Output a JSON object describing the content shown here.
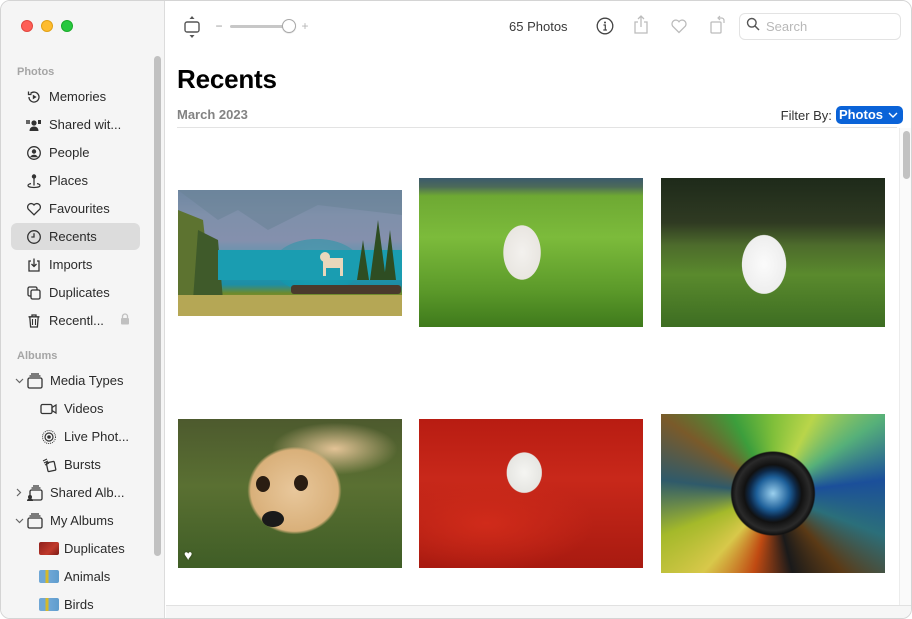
{
  "window": {
    "traffic_lights": [
      "close",
      "minimize",
      "maximize"
    ]
  },
  "sidebar": {
    "sections": [
      {
        "label": "Photos",
        "items": [
          {
            "label": "Memories",
            "icon": "memories-icon",
            "selected": false
          },
          {
            "label": "Shared wit...",
            "icon": "shared-with-you-icon",
            "selected": false
          },
          {
            "label": "People",
            "icon": "people-icon",
            "selected": false
          },
          {
            "label": "Places",
            "icon": "places-icon",
            "selected": false
          },
          {
            "label": "Favourites",
            "icon": "heart-icon",
            "selected": false
          },
          {
            "label": "Recents",
            "icon": "clock-icon",
            "selected": true
          },
          {
            "label": "Imports",
            "icon": "imports-icon",
            "selected": false
          },
          {
            "label": "Duplicates",
            "icon": "duplicates-icon",
            "selected": false
          },
          {
            "label": "Recentl...",
            "icon": "trash-icon",
            "selected": false,
            "locked": true
          }
        ]
      },
      {
        "label": "Albums",
        "items": [
          {
            "label": "Media Types",
            "icon": "album-stack-icon",
            "expanded": true,
            "level": 0
          },
          {
            "label": "Videos",
            "icon": "video-icon",
            "level": 1
          },
          {
            "label": "Live Phot...",
            "icon": "live-photo-icon",
            "level": 1
          },
          {
            "label": "Bursts",
            "icon": "bursts-icon",
            "level": 1
          },
          {
            "label": "Shared Alb...",
            "icon": "shared-albums-icon",
            "expanded": false,
            "level": 0
          },
          {
            "label": "My Albums",
            "icon": "album-stack-icon",
            "expanded": true,
            "level": 0
          },
          {
            "label": "Duplicates",
            "icon": "album-thumbnail",
            "level": 1
          },
          {
            "label": "Animals",
            "icon": "album-thumbnail",
            "level": 1
          },
          {
            "label": "Birds",
            "icon": "album-thumbnail",
            "level": 1
          }
        ]
      }
    ]
  },
  "toolbar": {
    "zoom_minus": "−",
    "zoom_plus": "+",
    "zoom_level": 0.85,
    "photo_count": "65 Photos",
    "search_placeholder": "Search",
    "search_value": ""
  },
  "main": {
    "title": "Recents",
    "date_group": "March 2023",
    "filter_label": "Filter By:",
    "filter_value": "Photos",
    "photos": [
      {
        "subject": "Dog on bench by mountain lake",
        "favourite": false
      },
      {
        "subject": "White dog running through green grass",
        "favourite": false
      },
      {
        "subject": "White puppy sitting in grass",
        "favourite": false
      },
      {
        "subject": "Golden retriever puppy lying on grass",
        "favourite": true
      },
      {
        "subject": "White dog in red flower field",
        "favourite": false
      },
      {
        "subject": "Camera lens with colorful mosaic",
        "favourite": false
      }
    ]
  },
  "colors": {
    "accent": "#0a63d8",
    "sidebar_bg": "#f5f5f5",
    "selected_item_bg": "#dcdcdc"
  }
}
